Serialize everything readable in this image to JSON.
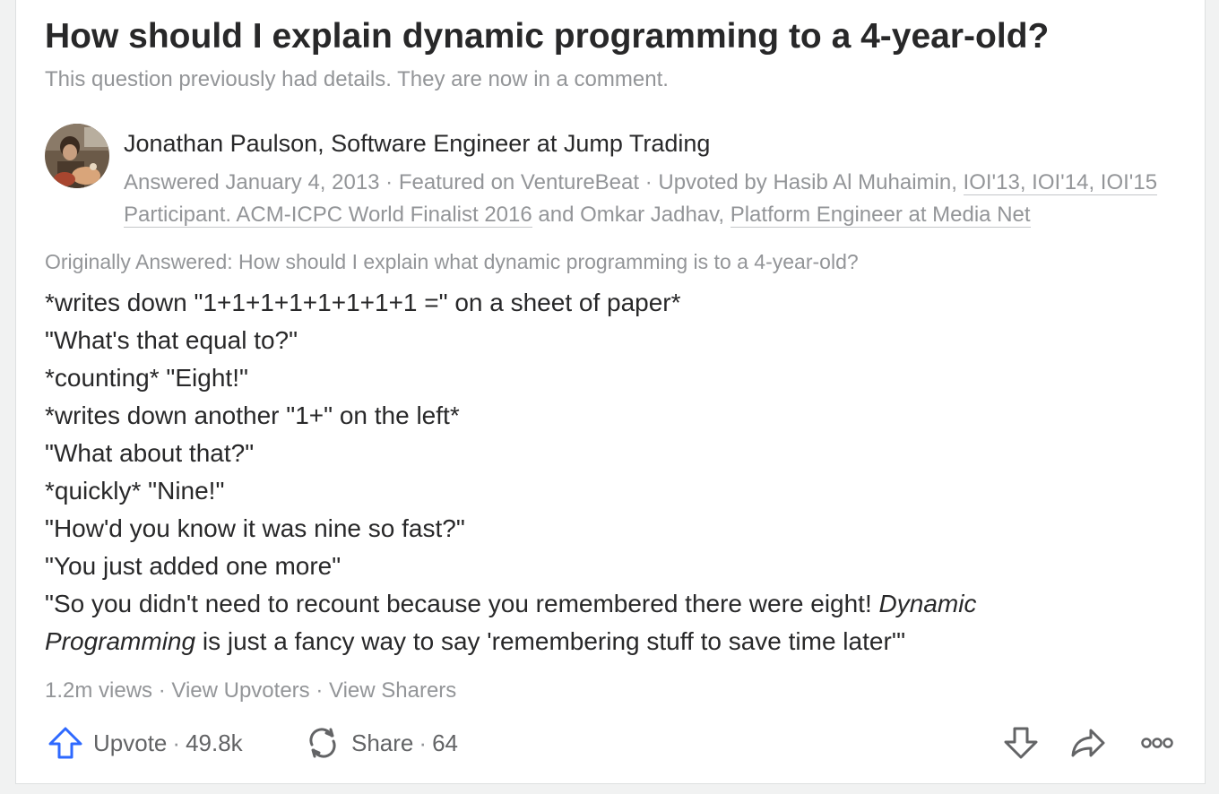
{
  "question": {
    "title": "How should I explain dynamic programming to a 4-year-old?",
    "details_note": "This question previously had details. They are now in a comment."
  },
  "answer": {
    "author": "Jonathan Paulson, Software Engineer at Jump Trading",
    "meta": {
      "answered": "Answered January 4, 2013",
      "dot": " · ",
      "featured": "Featured on VentureBeat",
      "upvoted_by": "Upvoted by Hasib Al Muhaimin, ",
      "upvoter1_credential": "IOI'13, IOI'14, IOI'15 Participant. ACM-ICPC World Finalist 2016",
      "and": " and Omkar Jadhav, ",
      "upvoter2_credential": "Platform Engineer at Media Net"
    },
    "originally_answered": "Originally Answered: How should I explain what dynamic programming is to a 4-year-old?",
    "lines": [
      "*writes down \"1+1+1+1+1+1+1+1 =\" on a sheet of paper*",
      "\"What's that equal to?\"",
      "*counting* \"Eight!\"",
      "*writes down another \"1+\" on the left*",
      "\"What about that?\"",
      "*quickly* \"Nine!\"",
      "\"How'd you know it was nine so fast?\"",
      "\"You just added one more\""
    ],
    "last_line": {
      "start": "\"So you didn't need to recount because you remembered there were eight! ",
      "emphasis": "Dynamic Programming",
      "end": " is just a fancy way to say 'remembering stuff to save time later'\""
    },
    "stats": {
      "views": "1.2m views",
      "dot": " · ",
      "view_upvoters": "View Upvoters",
      "view_sharers": "View Sharers"
    },
    "actions": {
      "upvote_label": "Upvote",
      "upvote_count": "49.8k",
      "share_label": "Share",
      "share_count": "64",
      "sep": "·"
    }
  },
  "icons": {
    "upvote": "upvote-arrow-icon",
    "share": "share-cycle-icon",
    "downvote": "downvote-arrow-icon",
    "forward": "forward-share-icon",
    "more": "more-options-icon"
  },
  "colors": {
    "upvote_blue": "#2e69ff",
    "text": "#282829",
    "muted": "#939598",
    "icon": "#636466"
  }
}
